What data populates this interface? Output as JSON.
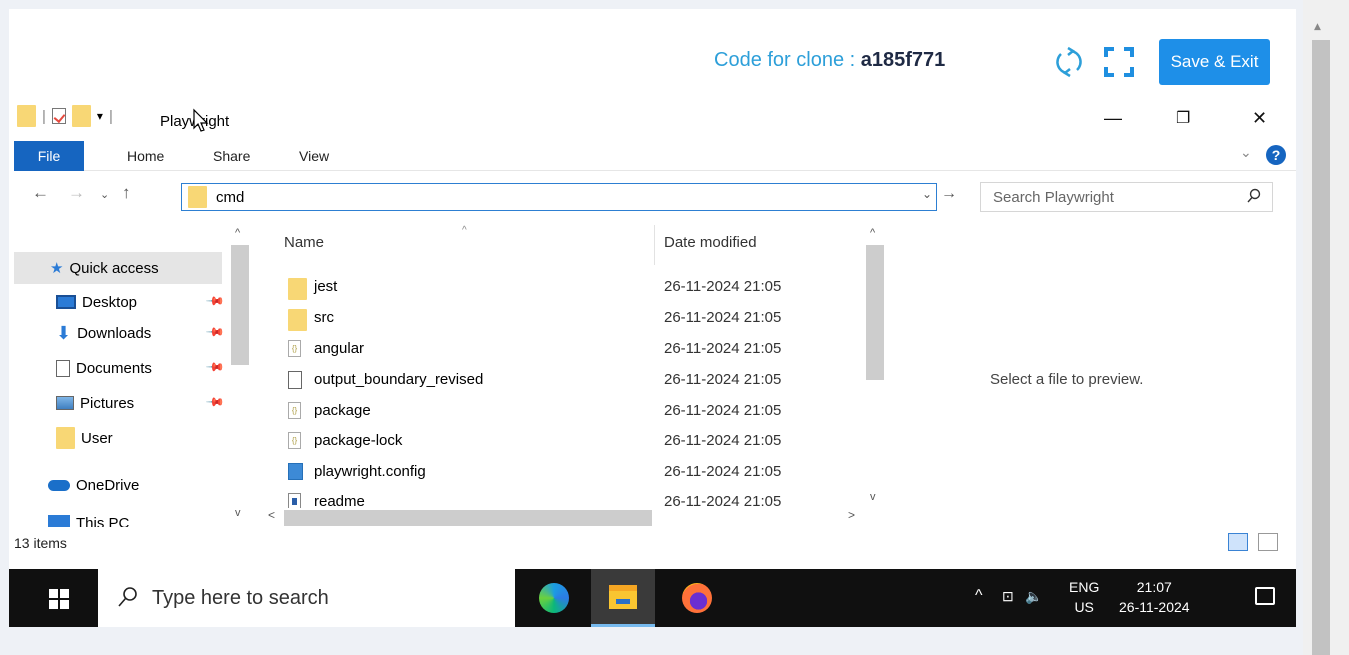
{
  "topbar": {
    "clone_label": "Code for clone : ",
    "clone_code": "a185f771",
    "save_exit_label": "Save & Exit",
    "refresh_icon": "refresh-icon",
    "fullscreen_icon": "fullscreen-icon"
  },
  "explorer": {
    "title": "Playwright",
    "ribbon_tabs": [
      "File",
      "Home",
      "Share",
      "View"
    ],
    "address_value": "cmd",
    "search_placeholder": "Search Playwright",
    "nav_items": [
      {
        "label": "Quick access",
        "icon": "star-icon",
        "pinned": false
      },
      {
        "label": "Desktop",
        "icon": "desktop-icon",
        "pinned": true
      },
      {
        "label": "Downloads",
        "icon": "download-icon",
        "pinned": true
      },
      {
        "label": "Documents",
        "icon": "documents-icon",
        "pinned": true
      },
      {
        "label": "Pictures",
        "icon": "pictures-icon",
        "pinned": true
      },
      {
        "label": "User",
        "icon": "folder-icon",
        "pinned": false
      },
      {
        "label": "OneDrive",
        "icon": "cloud-icon",
        "pinned": false
      },
      {
        "label": "This PC",
        "icon": "computer-icon",
        "pinned": false
      }
    ],
    "columns": {
      "name": "Name",
      "date": "Date modified"
    },
    "files": [
      {
        "name": "jest",
        "date": "26-11-2024 21:05",
        "type": "folder"
      },
      {
        "name": "src",
        "date": "26-11-2024 21:05",
        "type": "folder"
      },
      {
        "name": "angular",
        "date": "26-11-2024 21:05",
        "type": "json"
      },
      {
        "name": "output_boundary_revised",
        "date": "26-11-2024 21:05",
        "type": "text"
      },
      {
        "name": "package",
        "date": "26-11-2024 21:05",
        "type": "json"
      },
      {
        "name": "package-lock",
        "date": "26-11-2024 21:05",
        "type": "json"
      },
      {
        "name": "playwright.config",
        "date": "26-11-2024 21:05",
        "type": "ts"
      },
      {
        "name": "readme",
        "date": "26-11-2024 21:05",
        "type": "md"
      }
    ],
    "preview_text": "Select a file to preview.",
    "status_count": "13 items"
  },
  "taskbar": {
    "search_placeholder": "Type here to search",
    "language": "ENG",
    "region": "US",
    "time": "21:07",
    "date": "26-11-2024"
  }
}
